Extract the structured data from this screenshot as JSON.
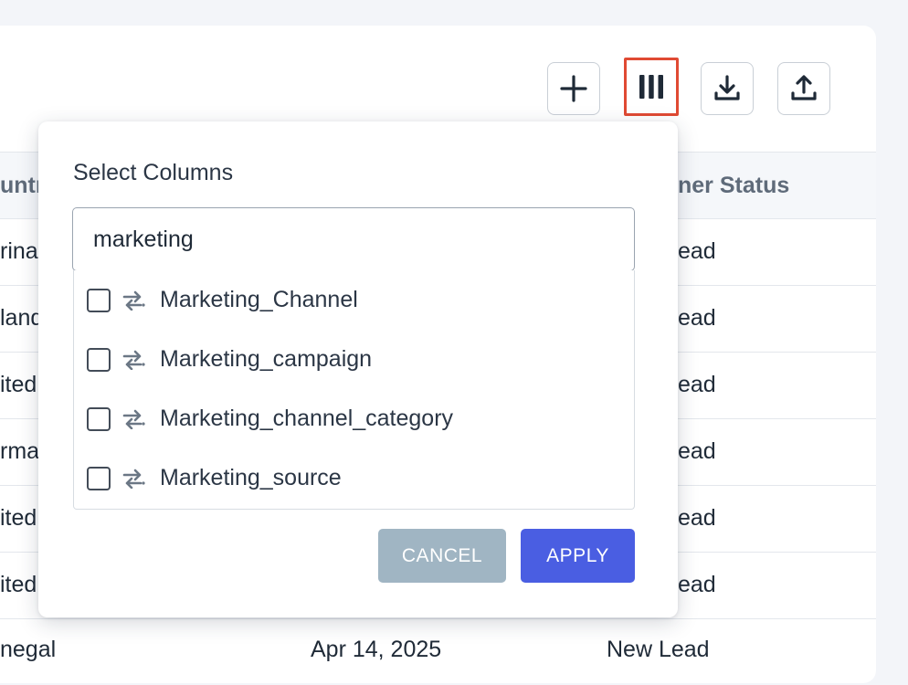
{
  "toolbar": {
    "add_icon": "plus-icon",
    "columns_icon": "columns-icon",
    "download_icon": "download-icon",
    "upload_icon": "upload-icon"
  },
  "table": {
    "headers": {
      "country": "untr",
      "status": "ner Status"
    },
    "rows": [
      {
        "country": "rina",
        "date": "",
        "status": "ead"
      },
      {
        "country": "land",
        "date": "",
        "status": "ead"
      },
      {
        "country": "ited",
        "date": "",
        "status": "ead"
      },
      {
        "country": "rma",
        "date": "",
        "status": "ead"
      },
      {
        "country": "ited",
        "date": "",
        "status": "ead"
      },
      {
        "country": "ited",
        "date": "",
        "status": "ead"
      },
      {
        "country": "negal",
        "date": "Apr 14, 2025",
        "status": "New Lead"
      }
    ]
  },
  "dropdown": {
    "title": "Select Columns",
    "search_value": "marketing",
    "options": [
      {
        "label": "Marketing_Channel",
        "checked": false
      },
      {
        "label": "Marketing_campaign",
        "checked": false
      },
      {
        "label": "Marketing_channel_category",
        "checked": false
      },
      {
        "label": "Marketing_source",
        "checked": false
      }
    ],
    "cancel_label": "CANCEL",
    "apply_label": "APPLY"
  },
  "colors": {
    "accent": "#4a5ee2",
    "cancel": "#a0b5c3",
    "highlight": "#e04a33"
  }
}
